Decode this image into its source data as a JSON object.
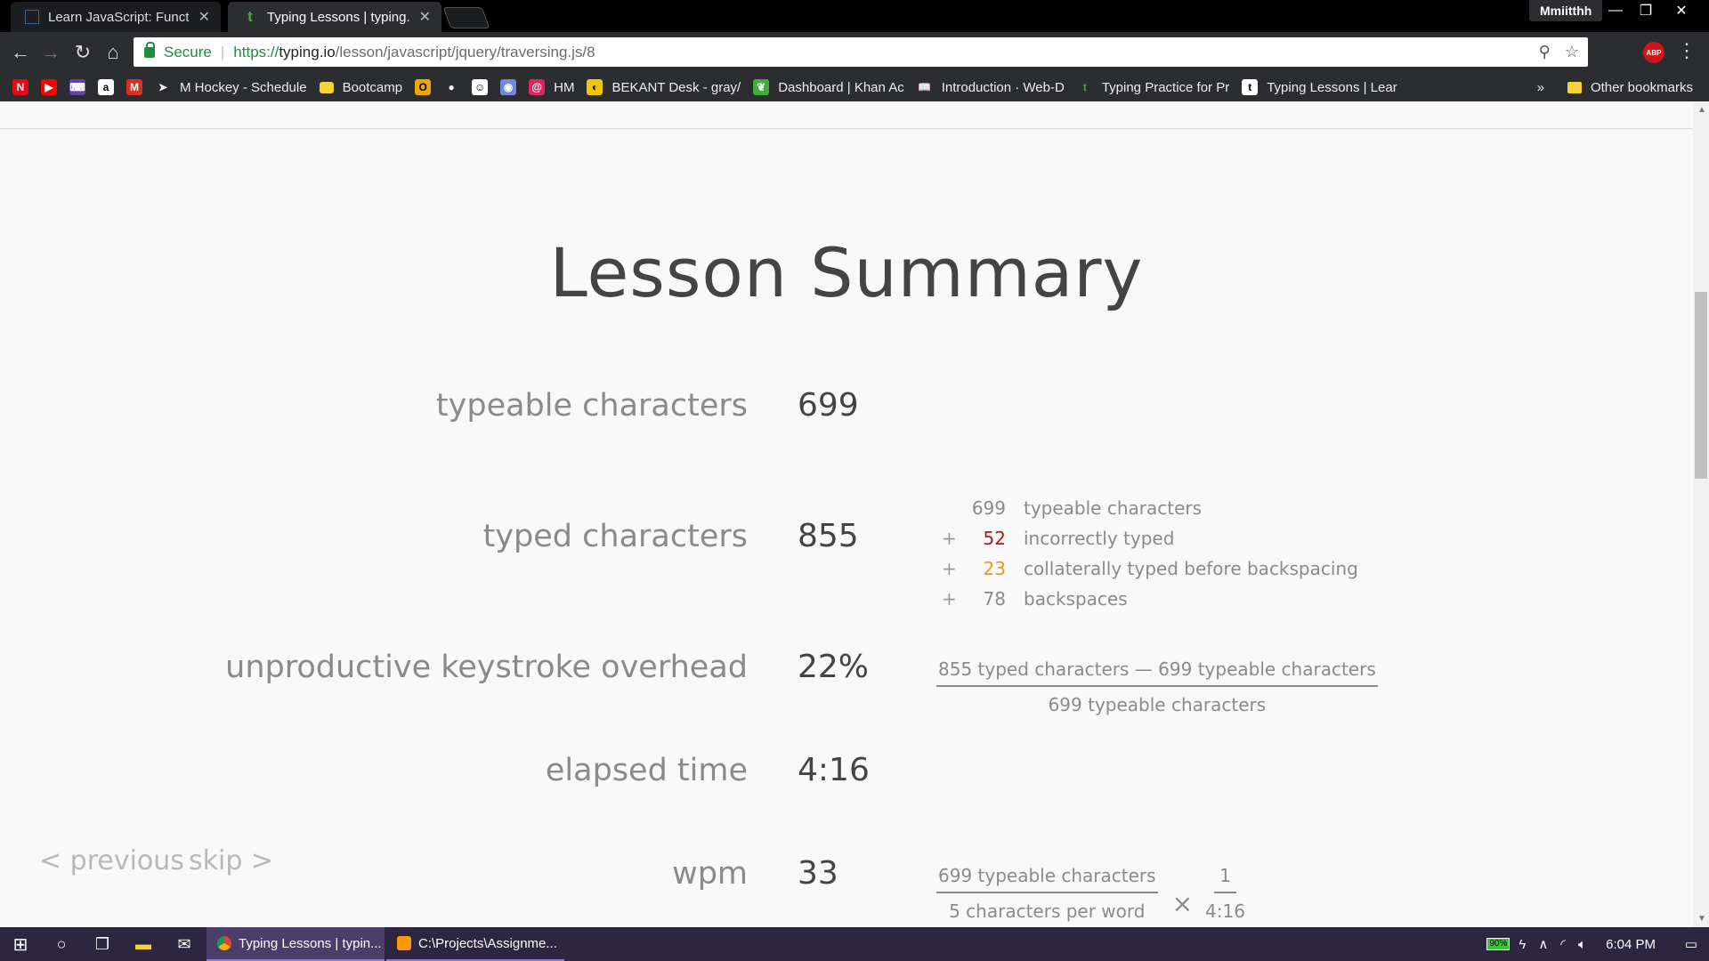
{
  "browser": {
    "tabs": [
      {
        "title": "Learn JavaScript: Functio",
        "active": false
      },
      {
        "title": "Typing Lessons | typing.i",
        "active": true
      }
    ],
    "profile": "Mmiitthh",
    "window_controls": {
      "minimize": "—",
      "restore": "❐",
      "close": "✕"
    },
    "security_label": "Secure",
    "url": {
      "scheme": "https://",
      "host": "typing.io",
      "path": "/lesson/javascript/jquery/traversing.js/8"
    },
    "abp_label": "ABP",
    "bookmarks": [
      {
        "label": "",
        "icon": "netflix-icon",
        "glyph": "N",
        "color": "#e50914"
      },
      {
        "label": "",
        "icon": "youtube-icon",
        "glyph": "▶",
        "color": "#ff0000"
      },
      {
        "label": "",
        "icon": "twitch-icon",
        "glyph": "⌨",
        "color": "#6441a5"
      },
      {
        "label": "",
        "icon": "amazon-icon",
        "glyph": "a",
        "color": "#ffffff"
      },
      {
        "label": "",
        "icon": "gmail-icon",
        "glyph": "M",
        "color": "#d93025"
      },
      {
        "label": "M Hockey - Schedule",
        "icon": "hockey-icon",
        "glyph": "➤",
        "color": "#2b2d31"
      },
      {
        "label": "Bootcamp",
        "icon": "folder-icon",
        "glyph": "",
        "color": "#f4d23a"
      },
      {
        "label": "",
        "icon": "orange-icon",
        "glyph": "O",
        "color": "#f0a500"
      },
      {
        "label": "",
        "icon": "apple-icon",
        "glyph": "●",
        "color": "#2b2d31"
      },
      {
        "label": "",
        "icon": "reddit-icon",
        "glyph": "☺",
        "color": "#ffffff"
      },
      {
        "label": "",
        "icon": "discord-icon",
        "glyph": "◉",
        "color": "#7289da"
      },
      {
        "label": "HM",
        "icon": "hm-icon",
        "glyph": "@",
        "color": "#e0245e"
      },
      {
        "label": "BEKANT Desk - gray/",
        "icon": "ikea-icon",
        "glyph": "◐",
        "color": "#f2c500"
      },
      {
        "label": "Dashboard | Khan Ac",
        "icon": "khan-icon",
        "glyph": "❦",
        "color": "#3fad3a"
      },
      {
        "label": "Introduction · Web-D",
        "icon": "book-icon",
        "glyph": "📖",
        "color": "#2b2d31"
      },
      {
        "label": "Typing Practice for Pr",
        "icon": "typing-icon",
        "glyph": "t",
        "color": "#2b2d31"
      },
      {
        "label": "Typing Lessons | Lear",
        "icon": "page-icon",
        "glyph": "t",
        "color": "#ffffff"
      }
    ],
    "overflow": "»",
    "other_bookmarks": "Other bookmarks"
  },
  "page": {
    "title": "Lesson Summary",
    "rows": [
      {
        "label": "typeable characters",
        "value": "699"
      },
      {
        "label": "typed characters",
        "value": "855"
      },
      {
        "label": "unproductive keystroke overhead",
        "value": "22%"
      },
      {
        "label": "elapsed time",
        "value": "4:16"
      },
      {
        "label": "wpm",
        "value": "33"
      }
    ],
    "typed_breakdown": [
      {
        "op": "",
        "num": "699",
        "label": "typeable characters",
        "color": ""
      },
      {
        "op": "+",
        "num": "52",
        "label": "incorrectly typed",
        "color": "red"
      },
      {
        "op": "+",
        "num": "23",
        "label": "collaterally typed before backspacing",
        "color": "orange"
      },
      {
        "op": "+",
        "num": "78",
        "label": "backspaces",
        "color": ""
      }
    ],
    "overhead_formula": {
      "numerator": "855 typed characters — 699 typeable characters",
      "denominator": "699 typeable characters"
    },
    "wpm_formula": {
      "numerator": "699 typeable characters",
      "denominator": "5 characters per word",
      "times": "×",
      "numerator2": "1",
      "denominator2": "4:16"
    },
    "nav": {
      "previous": "< previous",
      "skip": "skip >"
    }
  },
  "taskbar": {
    "apps": [
      {
        "label": "Typing Lessons | typin...",
        "active": true
      },
      {
        "label": "C:\\Projects\\Assignme...",
        "active": false
      }
    ],
    "battery": "90%",
    "time": "6:04 PM"
  },
  "colors": {
    "accent_green": "#1e8e3e",
    "incorrect_red": "#b01a1a",
    "collateral_orange": "#e39b20"
  }
}
